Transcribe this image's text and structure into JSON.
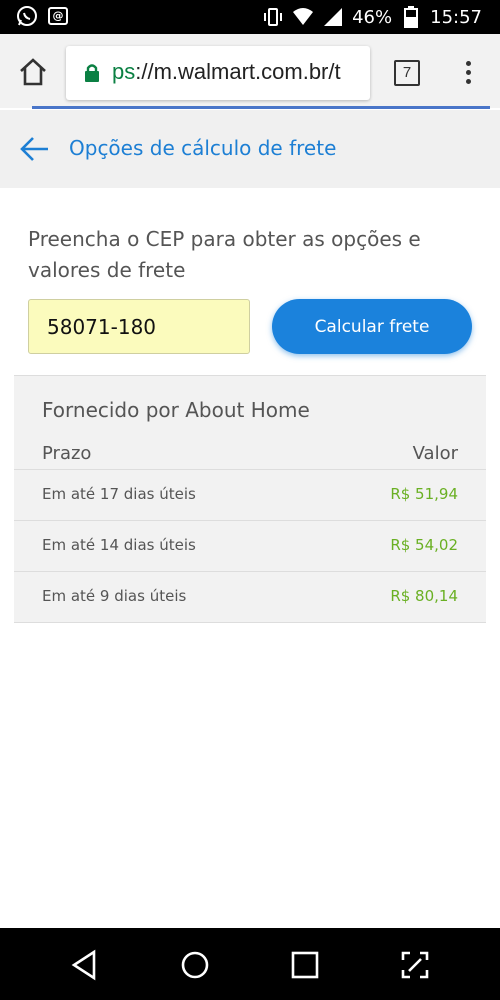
{
  "status_bar": {
    "battery": "46%",
    "time": "15:57"
  },
  "browser": {
    "url_scheme": "ps",
    "url_rest": "://m.walmart.com.br/t",
    "tab_count": "7"
  },
  "header": {
    "title": "Opções de cálculo de frete"
  },
  "form": {
    "instructions": "Preencha o CEP para obter as opções e valores de frete",
    "cep_value": "58071-180",
    "calc_button": "Calcular frete"
  },
  "results": {
    "provider": "Fornecido por About Home",
    "col_prazo": "Prazo",
    "col_valor": "Valor",
    "rows": [
      {
        "prazo": "Em até 17 dias úteis",
        "valor": "R$ 51,94"
      },
      {
        "prazo": "Em até 14 dias úteis",
        "valor": "R$ 54,02"
      },
      {
        "prazo": "Em até 9 dias úteis",
        "valor": "R$ 80,14"
      }
    ]
  },
  "colors": {
    "accent": "#1b82dc",
    "price": "#6ab023",
    "cep_bg": "#fbfbbd"
  }
}
